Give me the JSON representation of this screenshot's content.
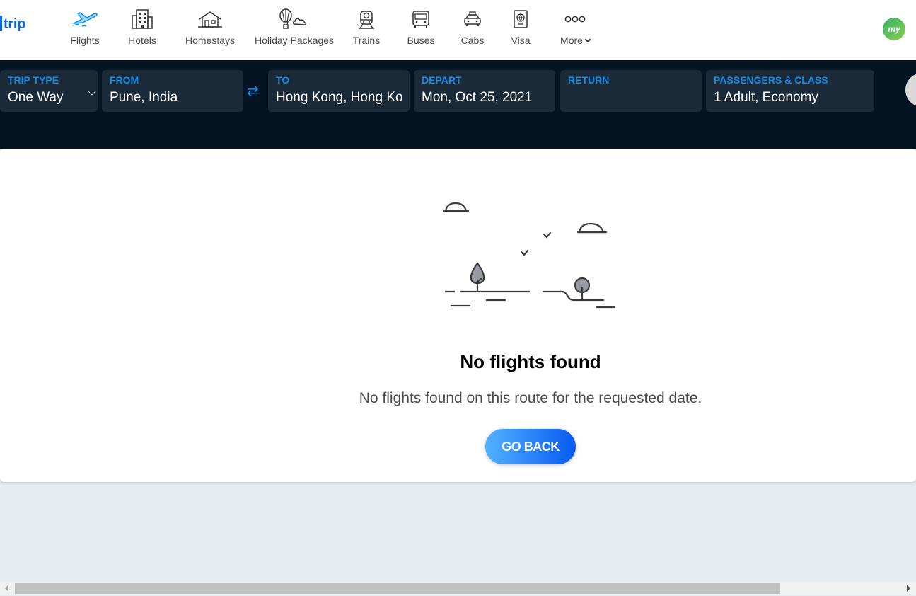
{
  "brand": {
    "logo_text": "trip"
  },
  "nav": [
    {
      "label": "Flights",
      "icon": "airplane-icon"
    },
    {
      "label": "Hotels",
      "icon": "hotel-building-icon"
    },
    {
      "label": "Homestays",
      "icon": "house-icon"
    },
    {
      "label": "Holiday Packages",
      "icon": "hot-air-balloon-icon"
    },
    {
      "label": "Trains",
      "icon": "train-icon"
    },
    {
      "label": "Buses",
      "icon": "bus-icon"
    },
    {
      "label": "Cabs",
      "icon": "taxi-icon"
    },
    {
      "label": "Visa",
      "icon": "passport-icon"
    },
    {
      "label": "More",
      "icon": "more-dots-icon"
    }
  ],
  "user": {
    "avatar_text": "my"
  },
  "search": {
    "trip_type": {
      "label": "TRIP TYPE",
      "value": "One Way"
    },
    "from": {
      "label": "FROM",
      "value": "Pune, India"
    },
    "to": {
      "label": "TO",
      "value": "Hong Kong, Hong Kong"
    },
    "depart": {
      "label": "DEPART",
      "value": "Mon, Oct 25, 2021"
    },
    "return": {
      "label": "RETURN",
      "value": ""
    },
    "passengers": {
      "label": "PASSENGERS & CLASS",
      "value": "1 Adult, Economy"
    }
  },
  "result": {
    "title": "No flights found",
    "message": "No flights found on this route for the requested date.",
    "button": "GO BACK"
  },
  "colors": {
    "accent": "#0a8df0",
    "band_bg": "#051423",
    "field_bg": "#1b2a39",
    "button_start": "#53b2fe",
    "button_end": "#065af3"
  }
}
